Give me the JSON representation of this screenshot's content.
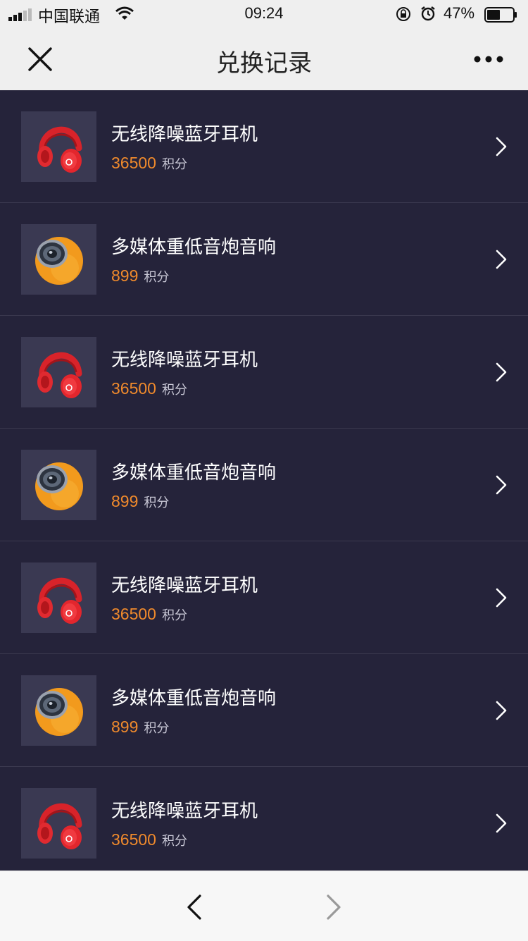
{
  "status_bar": {
    "carrier": "中国联通",
    "time": "09:24",
    "battery_pct": "47%"
  },
  "navbar": {
    "title": "兑换记录",
    "close_icon": "close-icon",
    "more_icon": "more-icon"
  },
  "records": [
    {
      "name": "无线降噪蓝牙耳机",
      "points": "36500",
      "unit": "积分",
      "image": "headphones"
    },
    {
      "name": "多媒体重低音炮音响",
      "points": "899",
      "unit": "积分",
      "image": "speaker"
    },
    {
      "name": "无线降噪蓝牙耳机",
      "points": "36500",
      "unit": "积分",
      "image": "headphones"
    },
    {
      "name": "多媒体重低音炮音响",
      "points": "899",
      "unit": "积分",
      "image": "speaker"
    },
    {
      "name": "无线降噪蓝牙耳机",
      "points": "36500",
      "unit": "积分",
      "image": "headphones"
    },
    {
      "name": "多媒体重低音炮音响",
      "points": "899",
      "unit": "积分",
      "image": "speaker"
    },
    {
      "name": "无线降噪蓝牙耳机",
      "points": "36500",
      "unit": "积分",
      "image": "headphones"
    }
  ],
  "bottom_bar": {
    "back_icon": "chevron-left-icon",
    "forward_icon": "chevron-right-icon"
  },
  "colors": {
    "background": "#25233a",
    "thumb_bg": "#3a3952",
    "points": "#f08a2c",
    "header": "#efefef"
  }
}
